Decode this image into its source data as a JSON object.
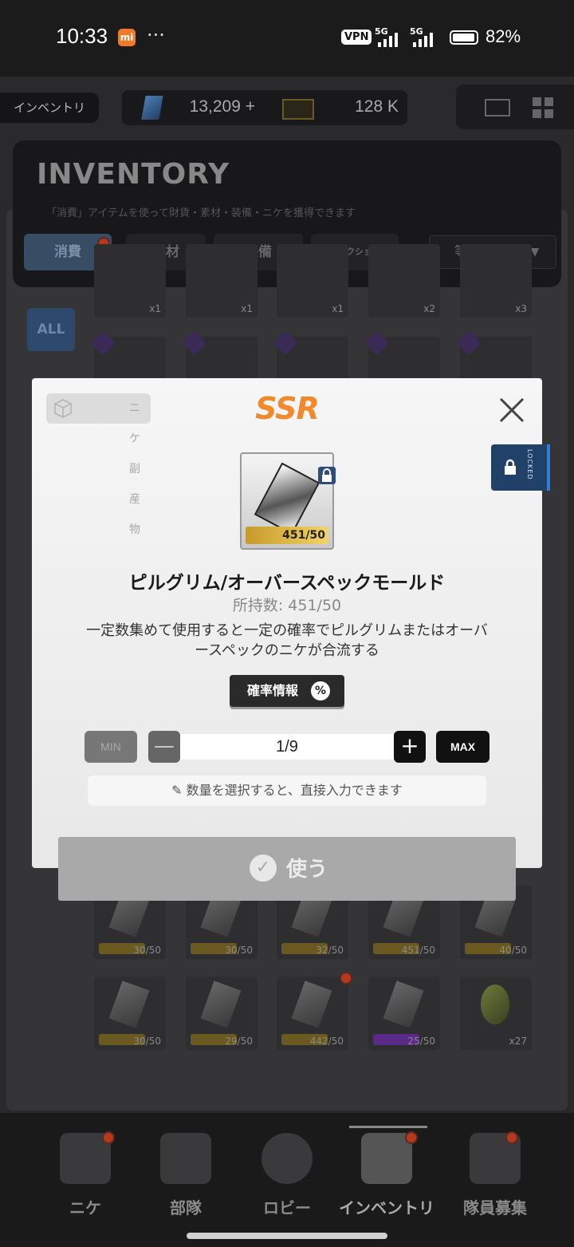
{
  "status_bar": {
    "time": "10:33",
    "mi_label": "mi",
    "dots": "···",
    "vpn": "VPN",
    "net1": "5G",
    "net2": "5G",
    "battery": "82%"
  },
  "top_bar": {
    "section": "インベントリ",
    "gems": "13,209",
    "gems_plus": "+",
    "credits": "128 K"
  },
  "inventory": {
    "title": "INVENTORY",
    "description": "「消費」アイテムを使って財貨・素材・装備・ニケを獲得できます",
    "tabs": [
      "消費",
      "素材",
      "装備",
      "コレクション"
    ],
    "sort_label": "等級",
    "filter_all": "ALL",
    "row1_counts": [
      "x1",
      "x1",
      "x1",
      "x2",
      "x3"
    ],
    "row3_counts": [
      "30/50",
      "30/50",
      "32/50",
      "451/50",
      "40/50"
    ],
    "row4_counts": [
      "30/50",
      "29/50",
      "442/50",
      "25/50",
      "x27"
    ]
  },
  "modal": {
    "category_chip": "ニケ副産物",
    "rarity": "SSR",
    "item_count": "451/50",
    "item_name": "ピルグリム/オーバースペックモールド",
    "owned": "所持数: 451/50",
    "description": "一定数集めて使用すると一定の確率でピルグリムまたはオーバースペックのニケが合流する",
    "probability_button": "確率情報",
    "min_label": "MIN",
    "max_label": "MAX",
    "quantity": "1/9",
    "hint": "数量を選択すると、直接入力できます",
    "use_button": "使う",
    "locked_label": "LOCKED"
  },
  "bottom_nav": {
    "items": [
      "ニケ",
      "部隊",
      "ロビー",
      "インベントリ",
      "隊員募集"
    ],
    "active": "インベントリ"
  },
  "colors": {
    "rarity_orange": "#f08a2c",
    "locked_blue": "#214168",
    "use_button_gray": "#a9a9a9"
  }
}
